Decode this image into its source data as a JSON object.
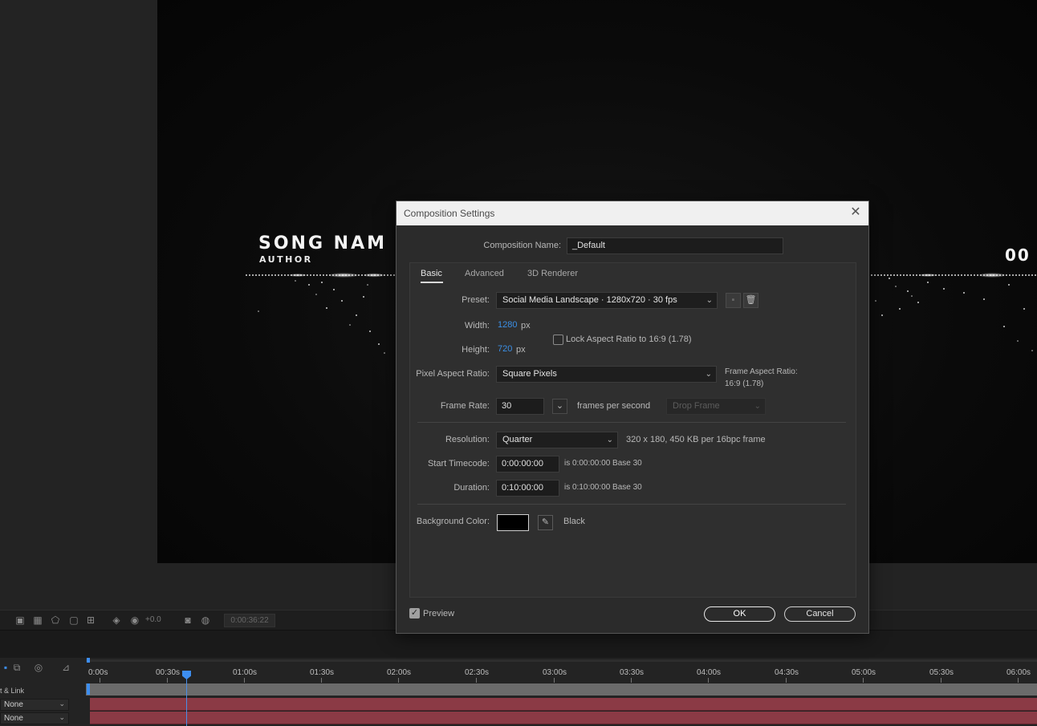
{
  "viewer": {
    "song_name": "SONG NAM",
    "author": "AUTHOR",
    "right_text": "00"
  },
  "viewer_toolbar": {
    "exposure": "+0.0",
    "timecode": "0:00:36:22"
  },
  "timeline": {
    "ruler_labels": [
      "0:00s",
      "00:30s",
      "01:00s",
      "01:30s",
      "02:00s",
      "02:30s",
      "03:00s",
      "03:30s",
      "04:00s",
      "04:30s",
      "05:00s",
      "05:30s",
      "06:00s"
    ],
    "parent_link_header": "t & Link",
    "rows": [
      {
        "parent": "None"
      },
      {
        "parent": "None"
      }
    ]
  },
  "dialog": {
    "title": "Composition Settings",
    "comp_name_label": "Composition Name:",
    "comp_name_value": "_Default",
    "tabs": [
      {
        "label": "Basic",
        "active": true
      },
      {
        "label": "Advanced",
        "active": false
      },
      {
        "label": "3D Renderer",
        "active": false
      }
    ],
    "preset_label": "Preset:",
    "preset_value": "Social Media Landscape  ·  1280x720 · 30 fps",
    "width_label": "Width:",
    "width_value": "1280",
    "width_unit": "px",
    "height_label": "Height:",
    "height_value": "720",
    "height_unit": "px",
    "lock_aspect_label": "Lock Aspect Ratio to 16:9 (1.78)",
    "lock_aspect_checked": false,
    "par_label": "Pixel Aspect Ratio:",
    "par_value": "Square Pixels",
    "frame_aspect_label": "Frame Aspect Ratio:",
    "frame_aspect_value": "16:9 (1.78)",
    "frame_rate_label": "Frame Rate:",
    "frame_rate_value": "30",
    "frame_rate_unit": "frames per second",
    "drop_frame_value": "Drop Frame",
    "resolution_label": "Resolution:",
    "resolution_value": "Quarter",
    "resolution_info": "320 x 180, 450 KB per 16bpc frame",
    "start_tc_label": "Start Timecode:",
    "start_tc_value": "0:00:00:00",
    "start_tc_info": "is 0:00:00:00  Base 30",
    "duration_label": "Duration:",
    "duration_value": "0:10:00:00",
    "duration_info": "is 0:10:00:00  Base 30",
    "bg_color_label": "Background Color:",
    "bg_color_value": "#000000",
    "bg_color_name": "Black",
    "preview_label": "Preview",
    "preview_checked": true,
    "ok_label": "OK",
    "cancel_label": "Cancel"
  },
  "colors": {
    "accent_blue": "#3b8fe6",
    "track_red": "#8b3a45",
    "dialog_bg": "#2b2b2b"
  }
}
